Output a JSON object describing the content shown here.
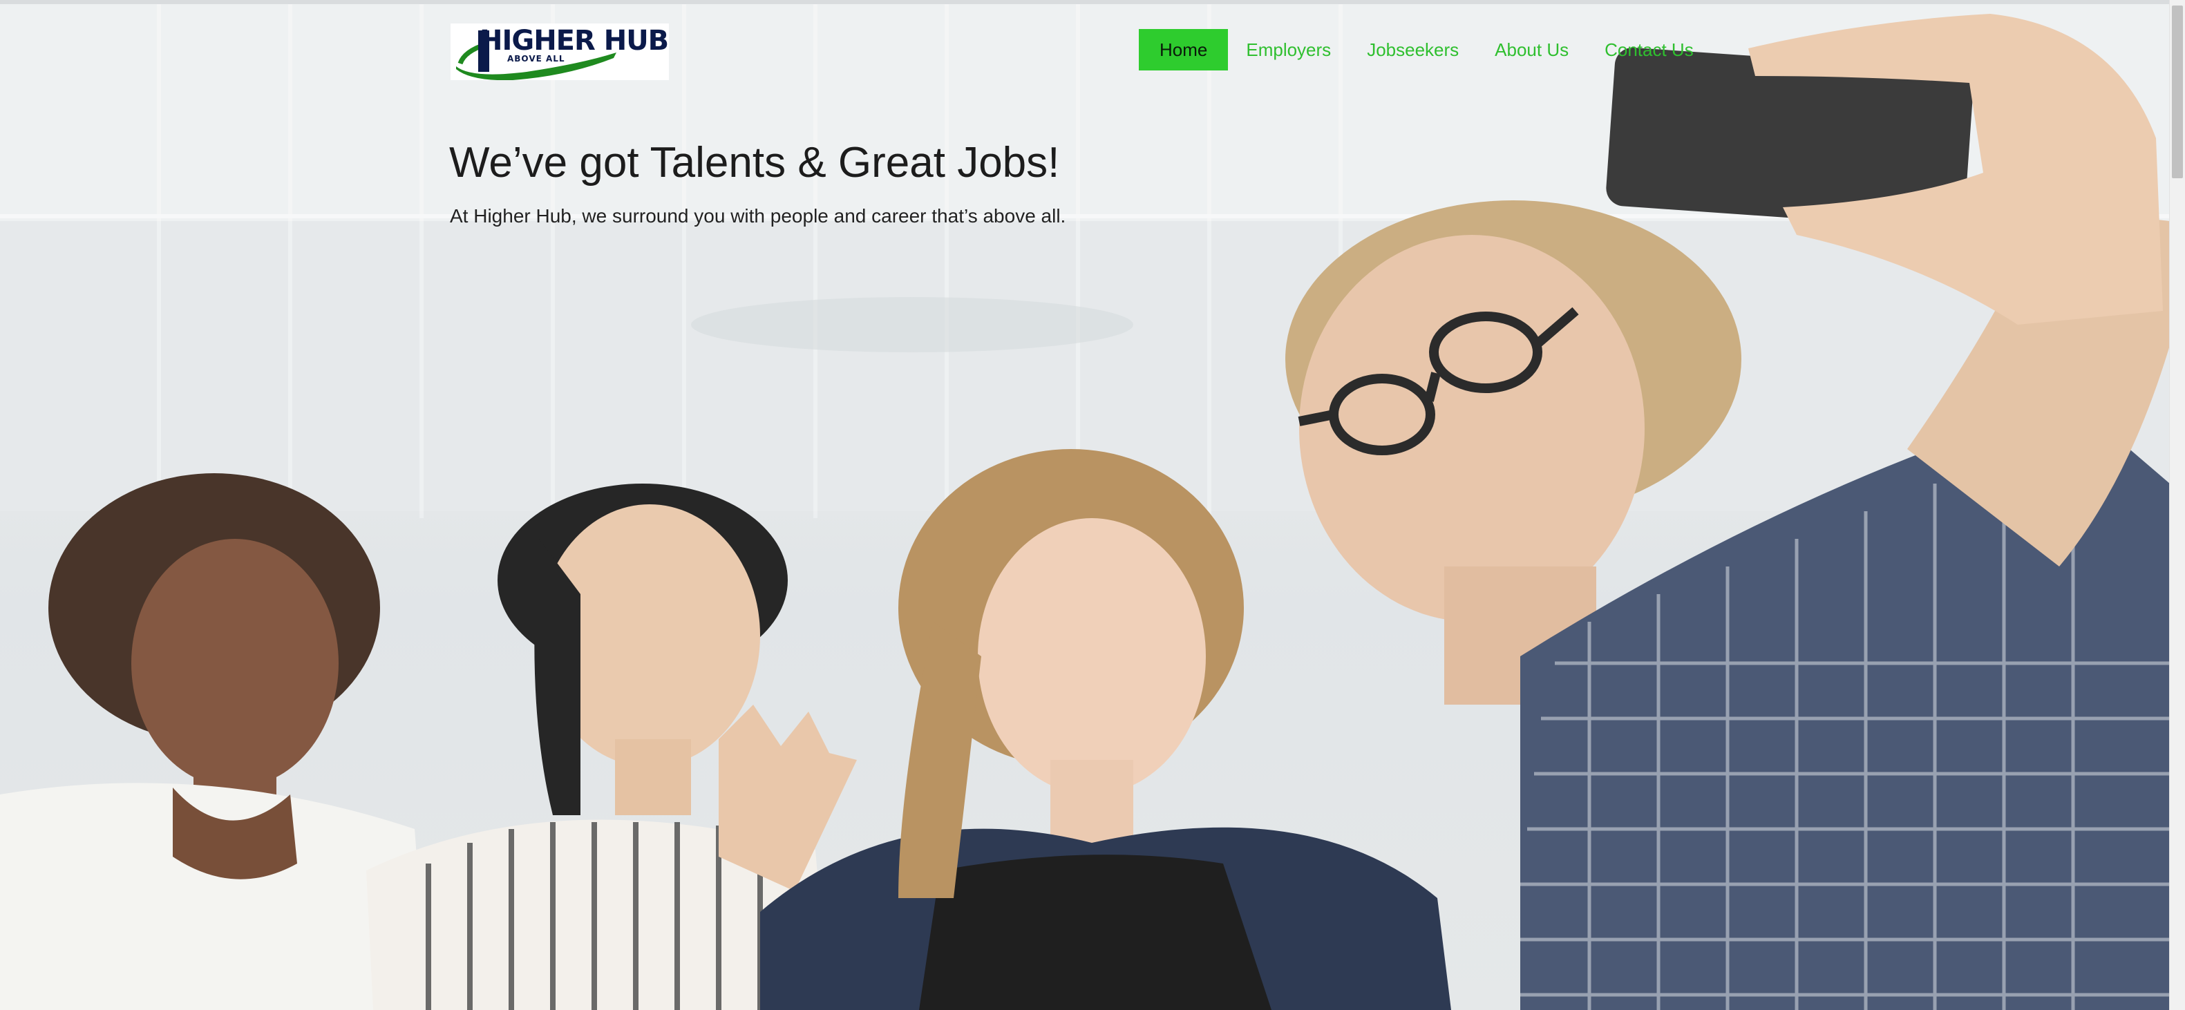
{
  "logo": {
    "name": "HIGHER HUB",
    "tagline": "ABOVE ALL"
  },
  "nav": {
    "items": [
      {
        "label": "Home",
        "active": true
      },
      {
        "label": "Employers",
        "active": false
      },
      {
        "label": "Jobseekers",
        "active": false
      },
      {
        "label": "About Us",
        "active": false
      },
      {
        "label": "Contact Us",
        "active": false
      }
    ]
  },
  "hero": {
    "headline": "We’ve got Talents & Great Jobs!",
    "subheadline": "At Higher Hub, we surround you with people and career that’s above all.",
    "image_description": "group-selfie-photo"
  },
  "colors": {
    "accent": "#2ecc2e",
    "nav_text": "#2fbf2f",
    "headline": "#1c1c1c",
    "logo_navy": "#0b1a4a",
    "logo_green": "#1f8a1f"
  }
}
